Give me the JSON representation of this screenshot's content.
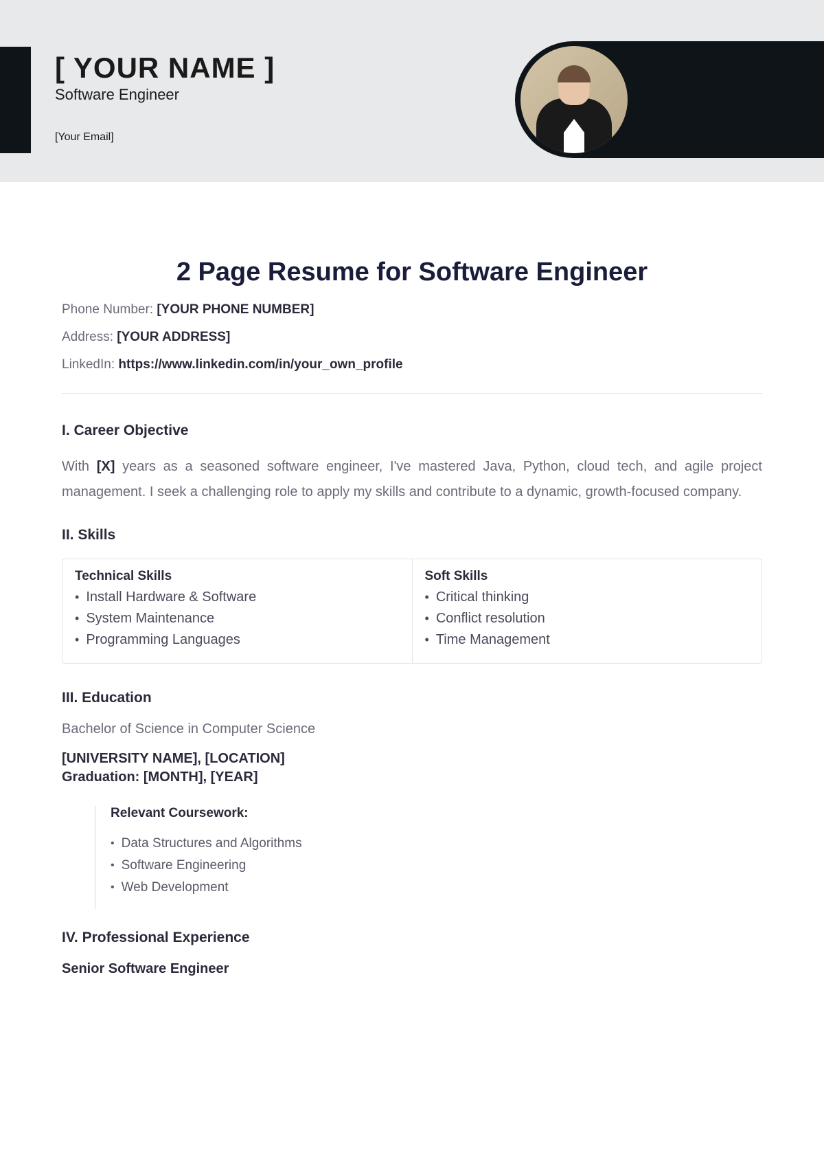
{
  "header": {
    "name": "[ YOUR NAME ]",
    "jobTitle": "Software Engineer",
    "email": "[Your Email]"
  },
  "resume": {
    "title": "2 Page Resume for Software Engineer",
    "contact": {
      "phoneLabel": "Phone Number: ",
      "phoneValue": "[YOUR PHONE NUMBER]",
      "addressLabel": "Address: ",
      "addressValue": "[YOUR ADDRESS]",
      "linkedinLabel": "LinkedIn: ",
      "linkedinValue": "https://www.linkedin.com/in/your_own_profile"
    },
    "sections": {
      "objective": {
        "heading": "I. Career Objective",
        "textPrefix": "With ",
        "textBold": "[X]",
        "textSuffix": " years as a seasoned software engineer, I've mastered Java, Python, cloud tech, and agile project management. I seek a challenging role to apply my skills and contribute to a dynamic, growth-focused company."
      },
      "skills": {
        "heading": "II. Skills",
        "technical": {
          "header": "Technical Skills",
          "items": [
            "Install Hardware & Software",
            "System Maintenance",
            "Programming Languages"
          ]
        },
        "soft": {
          "header": "Soft Skills",
          "items": [
            "Critical thinking",
            "Conflict resolution",
            "Time Management"
          ]
        }
      },
      "education": {
        "heading": "III. Education",
        "degree": "Bachelor of Science in Computer Science",
        "university": "[UNIVERSITY NAME], [LOCATION]",
        "graduation": "Graduation: [MONTH], [YEAR]",
        "courseworkHeading": "Relevant Coursework:",
        "coursework": [
          "Data Structures and Algorithms",
          "Software Engineering",
          "Web Development"
        ]
      },
      "experience": {
        "heading": "IV. Professional Experience",
        "role": "Senior Software Engineer"
      }
    }
  }
}
